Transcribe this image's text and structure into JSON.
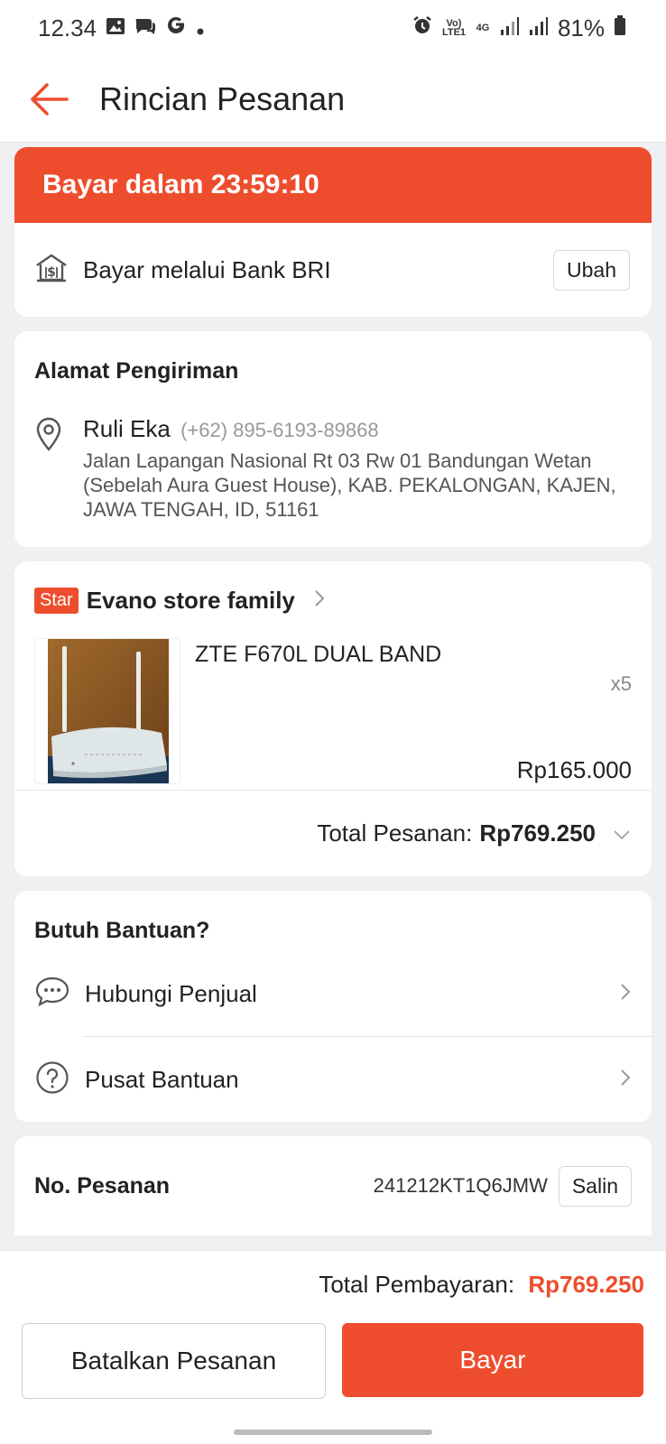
{
  "status_bar": {
    "time": "12.34",
    "network_volte": "Vo) LTE1",
    "network_4g": "4G",
    "battery": "81%"
  },
  "header": {
    "title": "Rincian Pesanan"
  },
  "payment": {
    "countdown": "Bayar dalam 23:59:10",
    "method_label": "Bayar melalui Bank BRI",
    "change_button": "Ubah"
  },
  "address": {
    "heading": "Alamat Pengiriman",
    "name": "Ruli Eka",
    "phone": "(+62) 895-6193-89868",
    "full": "Jalan Lapangan Nasional Rt 03 Rw 01 Bandungan Wetan (Sebelah Aura Guest House), KAB. PEKALONGAN, KAJEN, JAWA TENGAH, ID, 51161"
  },
  "shop": {
    "badge": "Star",
    "name": "Evano store family",
    "product": {
      "name": "ZTE F670L DUAL BAND",
      "qty": "x5",
      "price": "Rp165.000"
    },
    "order_total_label": "Total Pesanan:",
    "order_total_value": "Rp769.250"
  },
  "help": {
    "heading": "Butuh Bantuan?",
    "items": [
      {
        "label": "Hubungi Penjual",
        "icon": "chat-icon"
      },
      {
        "label": "Pusat Bantuan",
        "icon": "help-circle-icon"
      }
    ]
  },
  "order_no": {
    "label": "No. Pesanan",
    "value": "241212KT1Q6JMW",
    "copy_button": "Salin"
  },
  "footer": {
    "total_label": "Total Pembayaran:",
    "total_value": "Rp769.250",
    "cancel_button": "Batalkan Pesanan",
    "pay_button": "Bayar"
  },
  "colors": {
    "accent": "#ee4d2d",
    "background": "#f0f0f2"
  }
}
